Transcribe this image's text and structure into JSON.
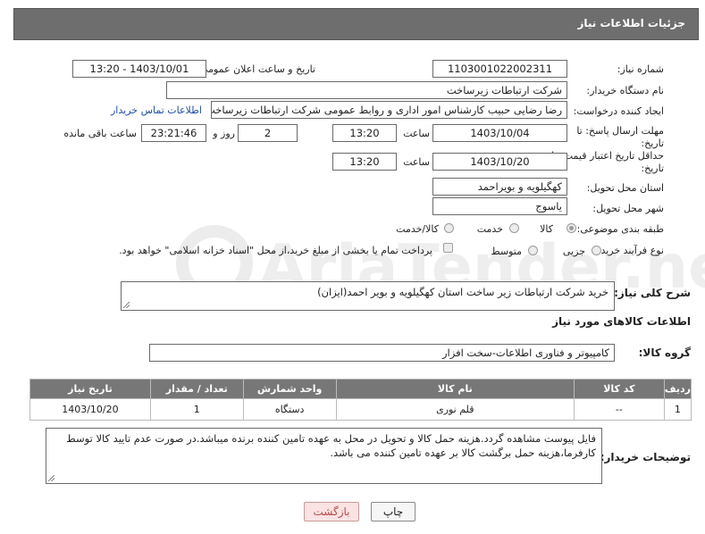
{
  "header": {
    "title": "جزئیات اطلاعات نیاز"
  },
  "need_number": {
    "label": "شماره نیاز:",
    "value": "1103001022002311"
  },
  "announce": {
    "label": "تاریخ و ساعت اعلان عمومی:",
    "value": "1403/10/01 - 13:20"
  },
  "buyer": {
    "label": "نام دستگاه خریدار:",
    "value": "شرکت ارتباطات زیرساخت"
  },
  "creator": {
    "label": "ایجاد کننده درخواست:",
    "value": "رضا رضایی حبیب کارشناس امور اداری و روابط عمومی شرکت ارتباطات زیرساخت",
    "contact_link": "اطلاعات تماس خریدار"
  },
  "deadline": {
    "label_1": "مهلت ارسال پاسخ: تا",
    "label_2": "تاریخ:",
    "date": "1403/10/04",
    "time_label": "ساعت",
    "time": "13:20",
    "days": "2",
    "days_label": "روز و",
    "remaining": "23:21:46",
    "remaining_label": "ساعت باقی مانده"
  },
  "validity": {
    "label_1": "حداقل تاریخ اعتبار قیمت: تا",
    "label_2": "تاریخ:",
    "date": "1403/10/20",
    "time_label": "ساعت",
    "time": "13:20"
  },
  "province": {
    "label": "استان محل تحویل:",
    "value": "کهگیلویه و بویراحمد"
  },
  "city": {
    "label": "شهر محل تحویل:",
    "value": "یاسوج"
  },
  "category": {
    "label": "طبقه بندی موضوعی:",
    "options": [
      "کالا",
      "خدمت",
      "کالا/خدمت"
    ],
    "selected": "کالا"
  },
  "process": {
    "label": "نوع فرآیند خرید :",
    "options": [
      "جزیی",
      "متوسط"
    ],
    "note": "پرداخت تمام یا بخشی از مبلغ خرید،از محل \"اسناد خزانه اسلامی\" خواهد بود."
  },
  "description": {
    "label": "شرح کلی نیاز:",
    "value": "خرید شرکت ارتباطات زیر ساخت استان کهگیلویه و بویر احمد(ایزان)"
  },
  "goods_section": {
    "title": "اطلاعات کالاهای مورد نیاز"
  },
  "goods_group": {
    "label": "گروه کالا:",
    "value": "کامپیوتر و فناوری اطلاعات-سخت افزار"
  },
  "goods_table": {
    "headers": [
      "ردیف",
      "کد کالا",
      "نام کالا",
      "واحد شمارش",
      "تعداد / مقدار",
      "تاریخ نیاز"
    ],
    "rows": [
      {
        "index": "1",
        "code": "--",
        "name": "قلم نوری",
        "unit": "دستگاه",
        "qty": "1",
        "date": "1403/10/20"
      }
    ]
  },
  "buyer_notes": {
    "label": "توضیحات خریدار:",
    "value": "فایل پیوست مشاهده گردد.هزینه حمل کالا و تحویل در محل به عهده تامین کننده برنده میباشد.در صورت عدم تایید کالا توسط کارفرما،هزینه حمل برگشت کالا بر عهده تامین کننده می باشد."
  },
  "buttons": {
    "print": "چاپ",
    "back": "بازگشت"
  },
  "colors": {
    "header_bg": "#6e6e6e",
    "table_header_bg": "#777777",
    "link": "#1f4fa3",
    "back_button_bg": "#fbe3e3",
    "back_button_text": "#b44a4a"
  }
}
